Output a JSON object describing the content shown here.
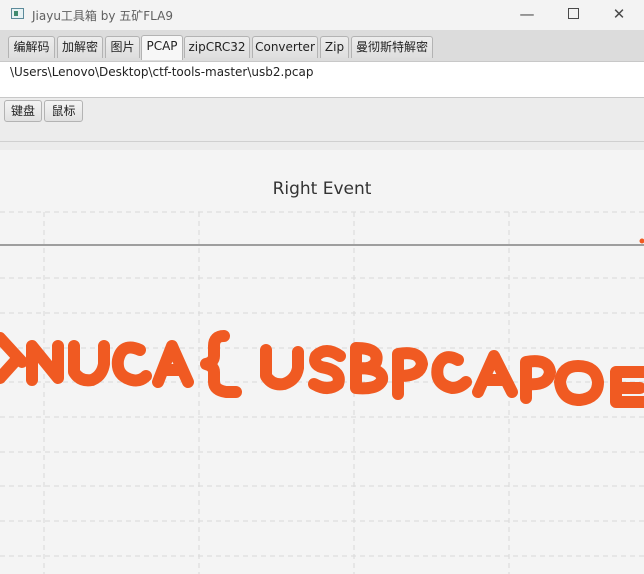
{
  "window": {
    "title": "Jiayu工具箱 by 五矿FLA9",
    "buttons": {
      "minimize": "—",
      "close": "✕"
    }
  },
  "tabs": [
    {
      "label": "编解码",
      "active": false
    },
    {
      "label": "加解密",
      "active": false
    },
    {
      "label": "图片",
      "active": false
    },
    {
      "label": "PCAP",
      "active": true
    },
    {
      "label": "zipCRC32",
      "active": false
    },
    {
      "label": "Converter",
      "active": false
    },
    {
      "label": "Zip",
      "active": false
    },
    {
      "label": "曼彻斯特解密",
      "active": false
    }
  ],
  "file_path": "\\Users\\Lenovo\\Desktop\\ctf-tools-master\\usb2.pcap",
  "sub_tabs": [
    {
      "label": "键盘"
    },
    {
      "label": "鼠标"
    }
  ],
  "chart": {
    "title": "Right Event",
    "stroke_color": "#f05a22",
    "grid": true,
    "drawn_text": "XNUCA{ USBPCAPOE"
  },
  "chart_data": {
    "type": "scatter",
    "title": "Right Event",
    "xlabel": "",
    "ylabel": "",
    "grid": true,
    "series": [
      {
        "values": "mouse right-button drag trail spelling XNUCA{ USBPCAPOE"
      }
    ]
  }
}
